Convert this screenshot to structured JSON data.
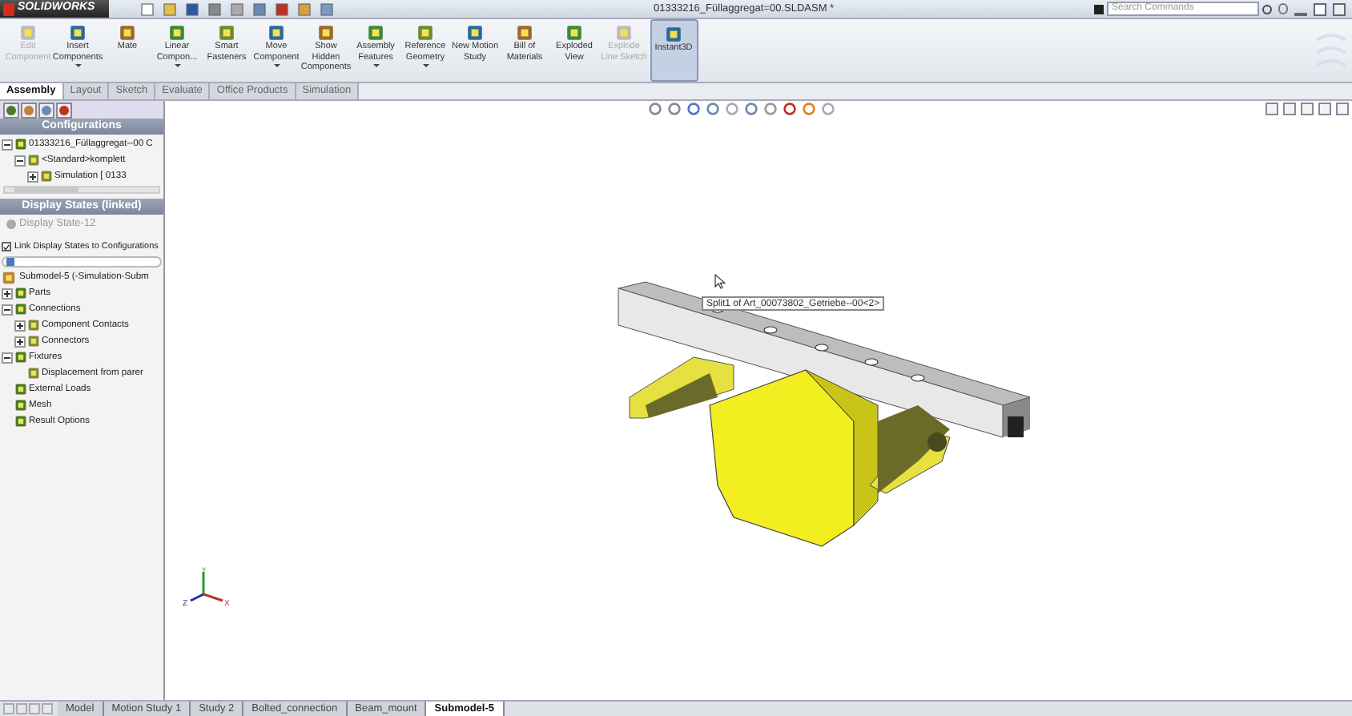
{
  "title_bar": {
    "logo": "SOLIDWORKS",
    "title": "01333216_Füllaggregat=00.SLDASM *",
    "search": {
      "placeholder": "Search Commands"
    }
  },
  "ribbon": [
    {
      "label": "Edit Component",
      "disabled": true,
      "selected": false,
      "dropdown": false
    },
    {
      "label": "Insert Components",
      "disabled": false,
      "selected": false,
      "dropdown": true
    },
    {
      "label": "Mate",
      "disabled": false,
      "selected": false,
      "dropdown": false
    },
    {
      "label": "Linear Compon...",
      "disabled": false,
      "selected": false,
      "dropdown": true
    },
    {
      "label": "Smart Fasteners",
      "disabled": false,
      "selected": false,
      "dropdown": false
    },
    {
      "label": "Move Component",
      "disabled": false,
      "selected": false,
      "dropdown": true
    },
    {
      "label": "Show Hidden Components",
      "disabled": false,
      "selected": false,
      "dropdown": false
    },
    {
      "label": "Assembly Features",
      "disabled": false,
      "selected": false,
      "dropdown": true
    },
    {
      "label": "Reference Geometry",
      "disabled": false,
      "selected": false,
      "dropdown": true
    },
    {
      "label": "New Motion Study",
      "disabled": false,
      "selected": false,
      "dropdown": false
    },
    {
      "label": "Bill of Materials",
      "disabled": false,
      "selected": false,
      "dropdown": false
    },
    {
      "label": "Exploded View",
      "disabled": false,
      "selected": false,
      "dropdown": false
    },
    {
      "label": "Explode Line Sketch",
      "disabled": true,
      "selected": false,
      "dropdown": false
    },
    {
      "label": "Instant3D",
      "disabled": false,
      "selected": true,
      "dropdown": false
    }
  ],
  "tabs": [
    {
      "label": "Assembly",
      "selected": true
    },
    {
      "label": "Layout",
      "selected": false
    },
    {
      "label": "Sketch",
      "selected": false
    },
    {
      "label": "Evaluate",
      "selected": false
    },
    {
      "label": "Office Products",
      "selected": false
    },
    {
      "label": "Simulation",
      "selected": false
    }
  ],
  "configurations": {
    "heading": "Configurations",
    "tree": [
      {
        "label": "01333216_Füllaggregat--00 C",
        "expanded": true,
        "children": [
          {
            "label": "<Standard>komplett",
            "expanded": true,
            "children": [
              {
                "label": "Simulation [ 0133",
                "expanded": false
              }
            ]
          }
        ]
      }
    ]
  },
  "display_states": {
    "heading": "Display States (linked)",
    "items": [
      "Display State-12"
    ]
  },
  "link_checkbox": {
    "label": "Link Display States to Configurations",
    "checked": true
  },
  "study_tree": {
    "root": "Submodel-5 (-Simulation-Subm",
    "items": [
      {
        "label": "Parts",
        "expanded": false
      },
      {
        "label": "Connections",
        "expanded": true,
        "children": [
          {
            "label": "Component Contacts",
            "expanded": false
          },
          {
            "label": "Connectors",
            "expanded": false
          }
        ]
      },
      {
        "label": "Fixtures",
        "expanded": true,
        "children": [
          {
            "label": "Displacement from parer"
          }
        ]
      },
      {
        "label": "External Loads"
      },
      {
        "label": "Mesh"
      },
      {
        "label": "Result Options"
      }
    ]
  },
  "viewport": {
    "tooltip": "Split1 of Art_00073802_Getriebe--00<2>",
    "axes": {
      "y": "Y",
      "z": "Z",
      "x": "X"
    }
  },
  "bottom_tabs": [
    {
      "label": "Model",
      "selected": false
    },
    {
      "label": "Motion Study 1",
      "selected": false
    },
    {
      "label": "Study 2",
      "selected": false
    },
    {
      "label": "Bolted_connection",
      "selected": false
    },
    {
      "label": "Beam_mount",
      "selected": false
    },
    {
      "label": "Submodel-5",
      "selected": true
    }
  ]
}
